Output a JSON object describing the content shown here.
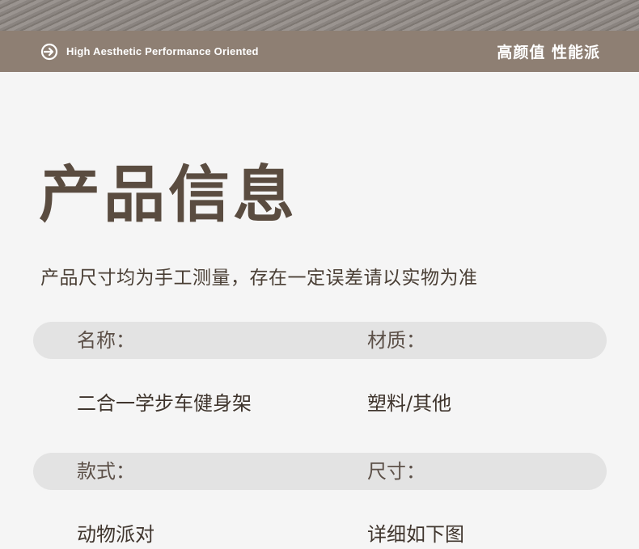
{
  "banner": {
    "slogan": "High Aesthetic Performance Oriented",
    "tagline": "高颜值 性能派",
    "icon": "arrow-circle-icon"
  },
  "section": {
    "title": "产品信息",
    "subtitle": "产品尺寸均为手工测量，存在一定误差请以实物为准"
  },
  "specs": [
    {
      "label": "名称：",
      "value": "二合一学步车健身架"
    },
    {
      "label": "材质：",
      "value": "塑料/其他"
    },
    {
      "label": "款式：",
      "value": "动物派对"
    },
    {
      "label": "尺寸：",
      "value": "详细如下图"
    }
  ],
  "colors": {
    "banner": "#8e7f73",
    "pill": "#e3e3e3",
    "text": "#4a3f35"
  }
}
